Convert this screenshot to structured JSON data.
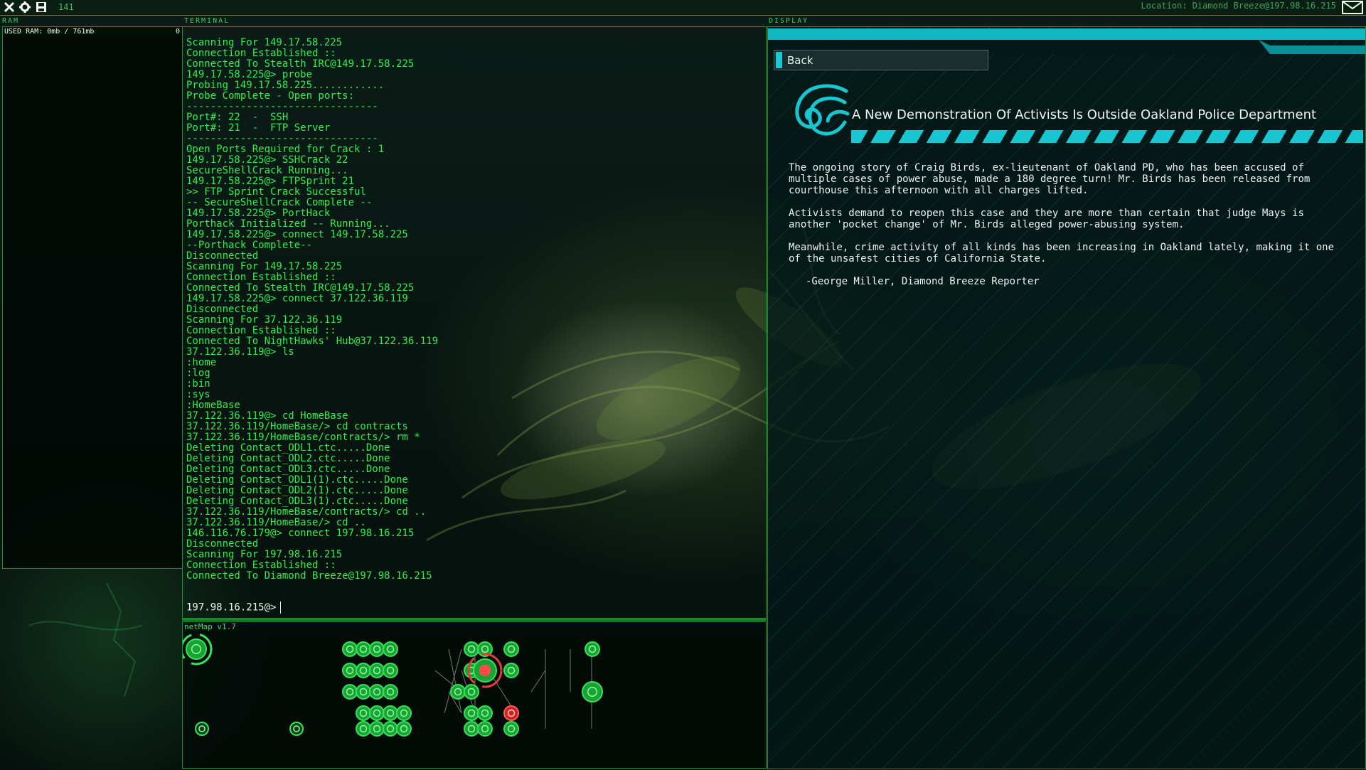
{
  "topbar": {
    "counter": "141",
    "location": "Location: Diamond Breeze@197.98.16.215"
  },
  "panels": {
    "ram_label": "RAM",
    "terminal_label": "TERMINAL",
    "display_label": "DISPLAY"
  },
  "ram": {
    "used_label": "USED RAM: 0mb / 761mb",
    "count": "0"
  },
  "terminal": {
    "lines": [
      "Scanning For 149.17.58.225",
      "Connection Established ::",
      "Connected To Stealth IRC@149.17.58.225",
      "149.17.58.225@> probe",
      "Probing 149.17.58.225............",
      "Probe Complete - Open ports:",
      "--------------------------------",
      "Port#: 22  -  SSH",
      "Port#: 21  -  FTP Server",
      "--------------------------------",
      "Open Ports Required for Crack : 1",
      "149.17.58.225@> SSHCrack 22",
      "SecureShellCrack Running...",
      "149.17.58.225@> FTPSprint 21",
      ">> FTP Sprint Crack Successful",
      "-- SecureShellCrack Complete --",
      "149.17.58.225@> PortHack",
      "Porthack Initialized -- Running...",
      "149.17.58.225@> connect 149.17.58.225",
      "--Porthack Complete--",
      "Disconnected",
      "Scanning For 149.17.58.225",
      "Connection Established ::",
      "Connected To Stealth IRC@149.17.58.225",
      "149.17.58.225@> connect 37.122.36.119",
      "Disconnected",
      "Scanning For 37.122.36.119",
      "Connection Established ::",
      "Connected To NightHawks' Hub@37.122.36.119",
      "37.122.36.119@> ls",
      ":home",
      ":log",
      ":bin",
      ":sys",
      ":HomeBase",
      "37.122.36.119@> cd HomeBase",
      "37.122.36.119/HomeBase/> cd contracts",
      "37.122.36.119/HomeBase/contracts/> rm *",
      "Deleting Contact_ODL1.ctc.....Done",
      "Deleting Contact_ODL2.ctc.....Done",
      "Deleting Contact_ODL3.ctc.....Done",
      "Deleting Contact_ODL1(1).ctc.....Done",
      "Deleting Contact_ODL2(1).ctc.....Done",
      "Deleting Contact_ODL3(1).ctc.....Done",
      "37.122.36.119/HomeBase/contracts/> cd ..",
      "37.122.36.119/HomeBase/> cd ..",
      "146.116.76.179@> connect 197.98.16.215",
      "Disconnected",
      "Scanning For 197.98.16.215",
      "Connection Established ::",
      "Connected To Diamond Breeze@197.98.16.215"
    ],
    "prompt": "197.98.16.215@>"
  },
  "netmap": {
    "title": "netMap v1.7"
  },
  "display": {
    "back_label": "Back",
    "headline": "A New Demonstration Of Activists Is Outside Oakland Police Department",
    "paragraphs": [
      "The ongoing story of Craig Birds, ex-lieutenant of Oakland PD, who has been accused of multiple cases of power abuse, made a 180 degree turn! Mr. Birds has been released from courthouse this afternoon with all charges lifted.",
      "Activists demand to reopen this case and they are more than certain that judge Mays is another 'pocket change' of Mr. Birds alleged power-abusing system.",
      "Meanwhile, crime activity of all kinds has been increasing in Oakland lately, making it one of the unsafest cities of California State."
    ],
    "signature": "-George Miller, Diamond Breeze Reporter"
  },
  "colors": {
    "terminal_green": "#2ff04a",
    "accent_cyan": "#18c6d2",
    "panel_border": "#1f8f35",
    "node_red": "#e23b3b"
  }
}
